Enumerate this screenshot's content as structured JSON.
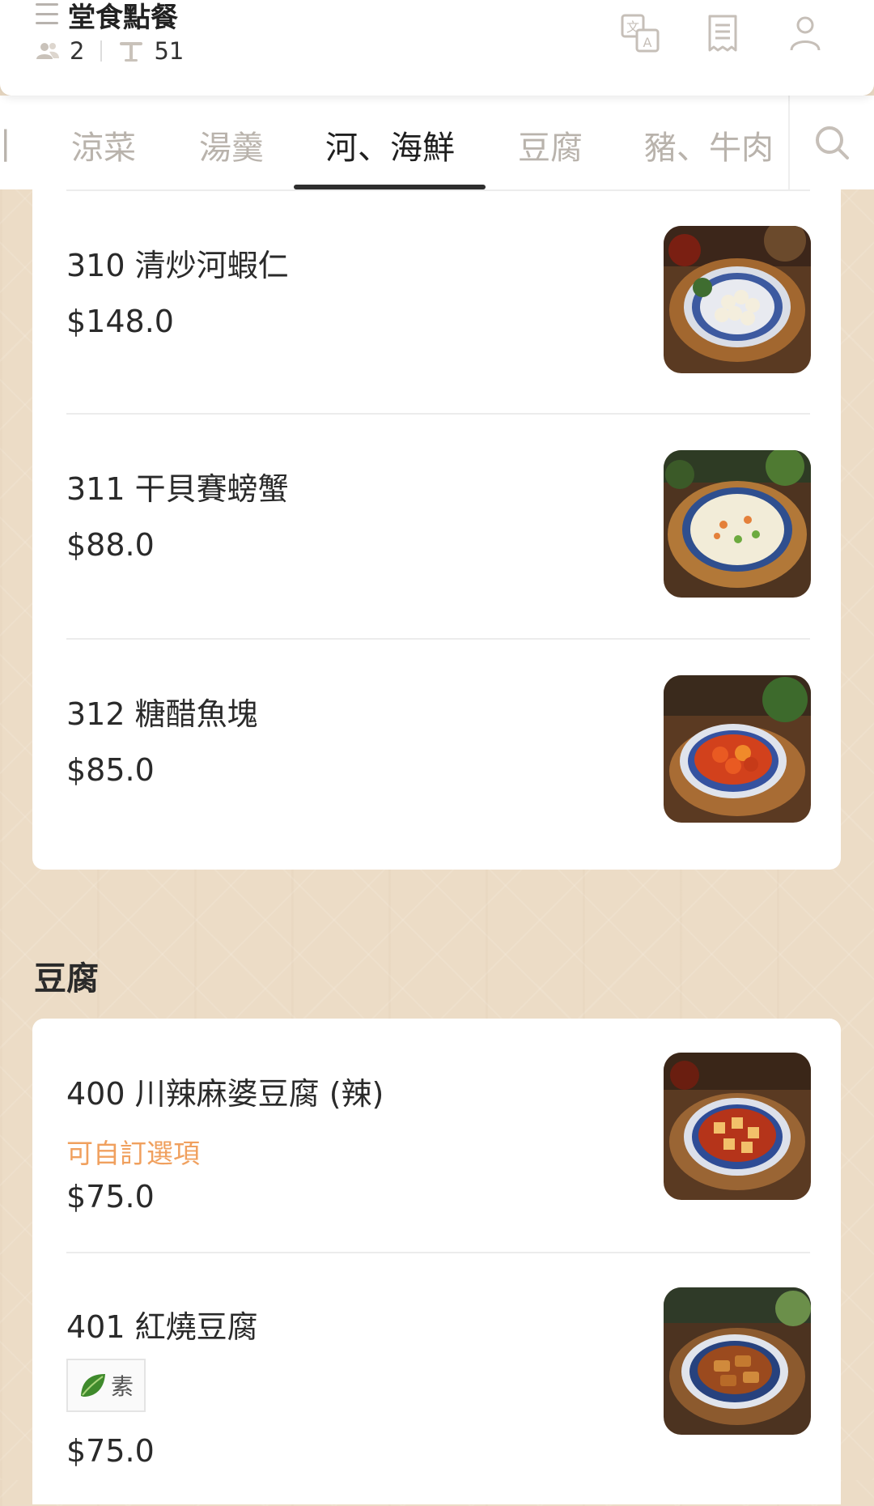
{
  "header": {
    "title": "堂食點餐",
    "guests": "2",
    "table_no": "51",
    "icons": [
      "menu-icon",
      "guests-icon",
      "table-icon",
      "translate-icon",
      "orders-icon",
      "user-icon"
    ]
  },
  "tabs": [
    {
      "label": "涼菜",
      "active": false
    },
    {
      "label": "湯羹",
      "active": false
    },
    {
      "label": "河、海鮮",
      "active": true
    },
    {
      "label": "豆腐",
      "active": false
    },
    {
      "label": "豬、牛肉",
      "active": false
    }
  ],
  "sections": [
    {
      "title": "",
      "items": [
        {
          "name": "310 清炒河蝦仁",
          "price": "$148.0"
        },
        {
          "name": "311 干貝賽螃蟹",
          "price": "$88.0"
        },
        {
          "name": "312 糖醋魚塊",
          "price": "$85.0"
        }
      ]
    },
    {
      "title": "豆腐",
      "items": [
        {
          "name": "400 川辣麻婆豆腐 (辣)",
          "option_text": "可自訂選項",
          "price": "$75.0"
        },
        {
          "name": "401 紅燒豆腐",
          "badge": "素",
          "price": "$75.0"
        }
      ]
    }
  ],
  "colors": {
    "background": "#ecdcc6",
    "accent_option": "#f0a05e",
    "tab_active": "#1f1f1f",
    "tab_inactive": "#b9b3ac"
  }
}
